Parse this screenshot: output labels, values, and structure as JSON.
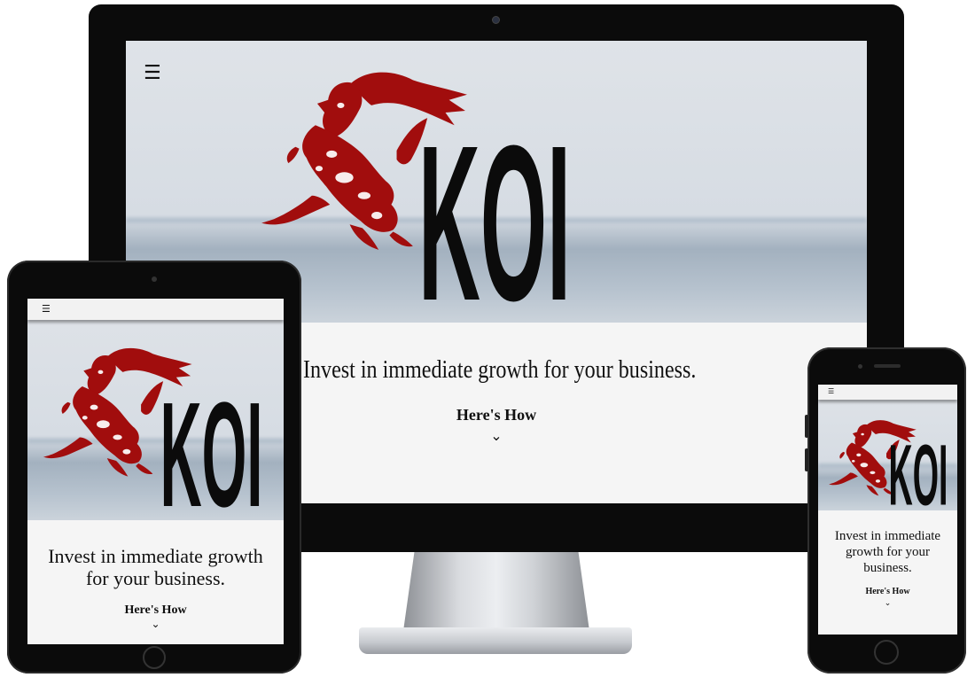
{
  "colors": {
    "brand_red": "#a10d0d",
    "ink": "#111111",
    "device_black": "#0b0b0b",
    "page_bg": "#f5f5f5",
    "sky": "#dfe3e8",
    "sea": "#a3b1bf"
  },
  "icons": {
    "menu": "hamburger-menu-icon",
    "scroll": "chevron-down-icon",
    "fish": "koi-fish-logo"
  },
  "site": {
    "logo_text": "KOI",
    "menu_glyph": "☰",
    "headline": "Invest in immediate growth for your business.",
    "cta_label": "Here's How",
    "chevron_glyph": "⌄"
  },
  "devices": [
    "desktop-monitor",
    "tablet",
    "phone"
  ]
}
